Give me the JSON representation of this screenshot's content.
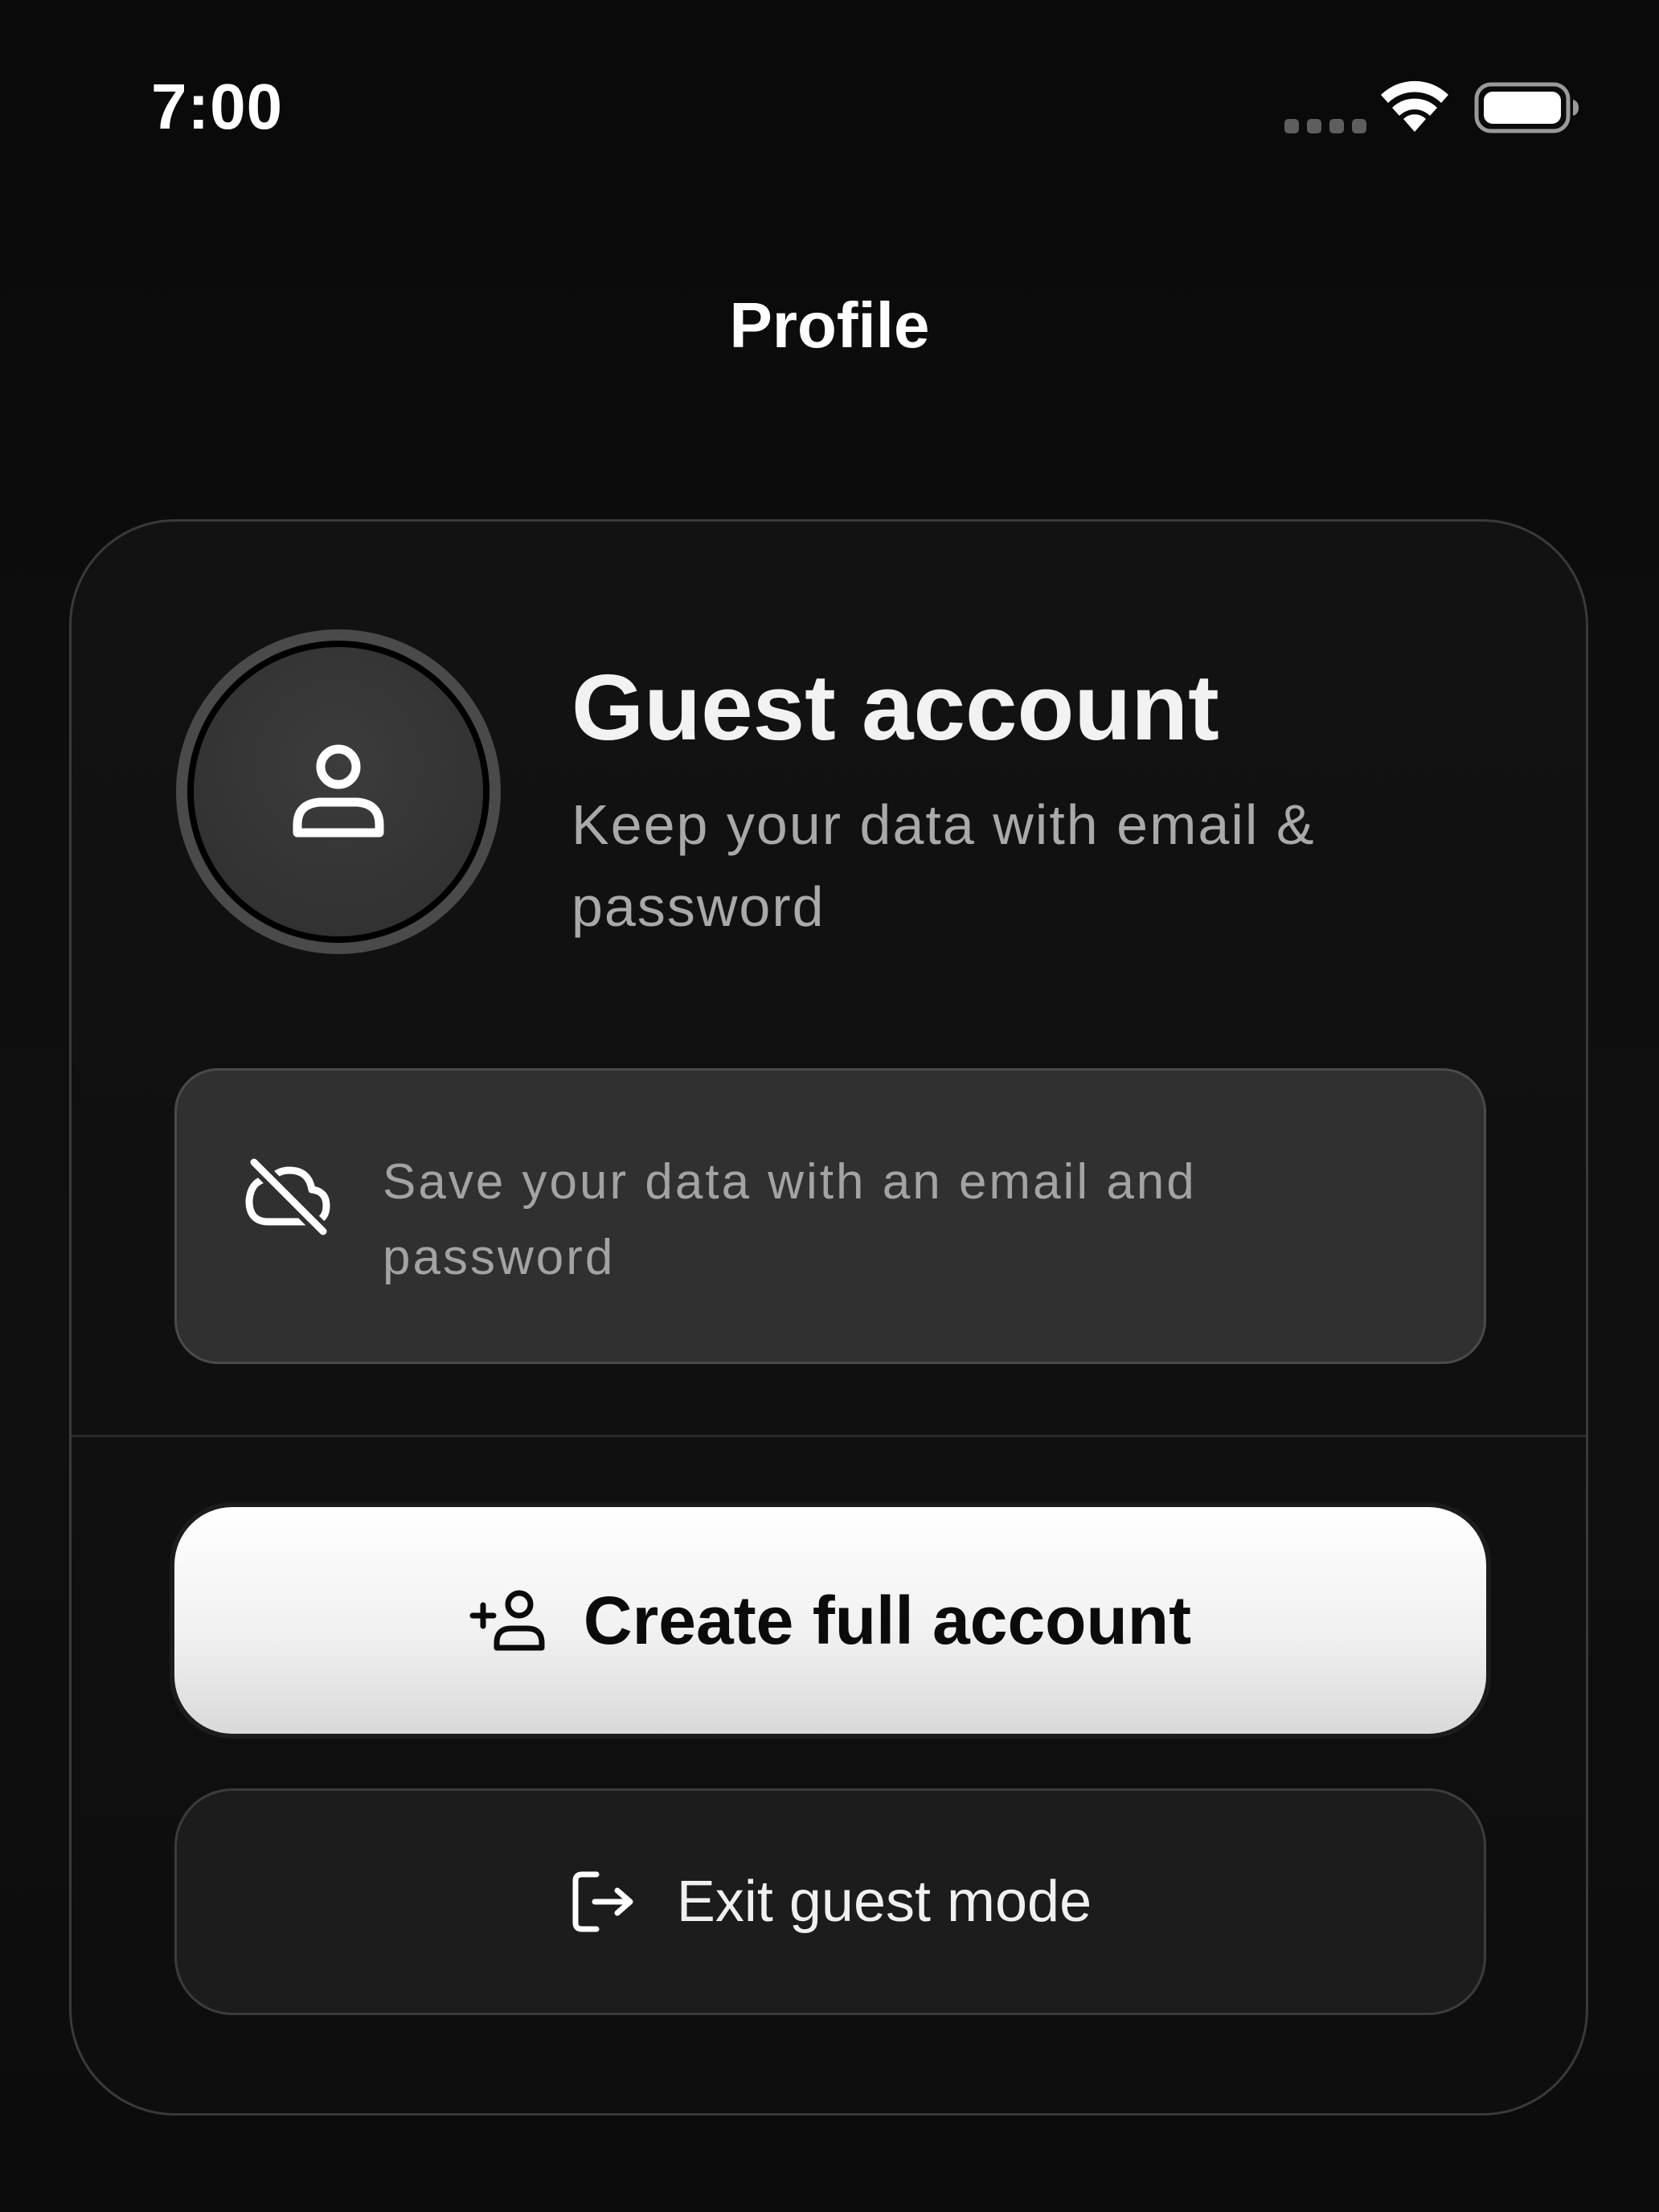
{
  "status_bar": {
    "time": "7:00",
    "wifi_icon": "wifi-icon",
    "battery_icon": "battery-icon",
    "signal_icon": "cellular-signal-dots-icon"
  },
  "nav": {
    "title": "Profile"
  },
  "profile_card": {
    "avatar_icon": "user-icon",
    "title": "Guest account",
    "subtitle": "Keep your data with email & password",
    "info": {
      "icon": "cloud-off-icon",
      "text": "Save your data with an email and password"
    },
    "primary_action": {
      "icon": "user-plus-icon",
      "label": "Create full account"
    },
    "secondary_action": {
      "icon": "logout-icon",
      "label": "Exit guest mode"
    }
  },
  "colors": {
    "background": "#0b0b0b",
    "card_border": "#3a3a3a",
    "info_box": "#303030",
    "muted_text": "#a9a9a9",
    "primary_button": "#f1f1f1",
    "secondary_button": "#1c1c1c"
  }
}
